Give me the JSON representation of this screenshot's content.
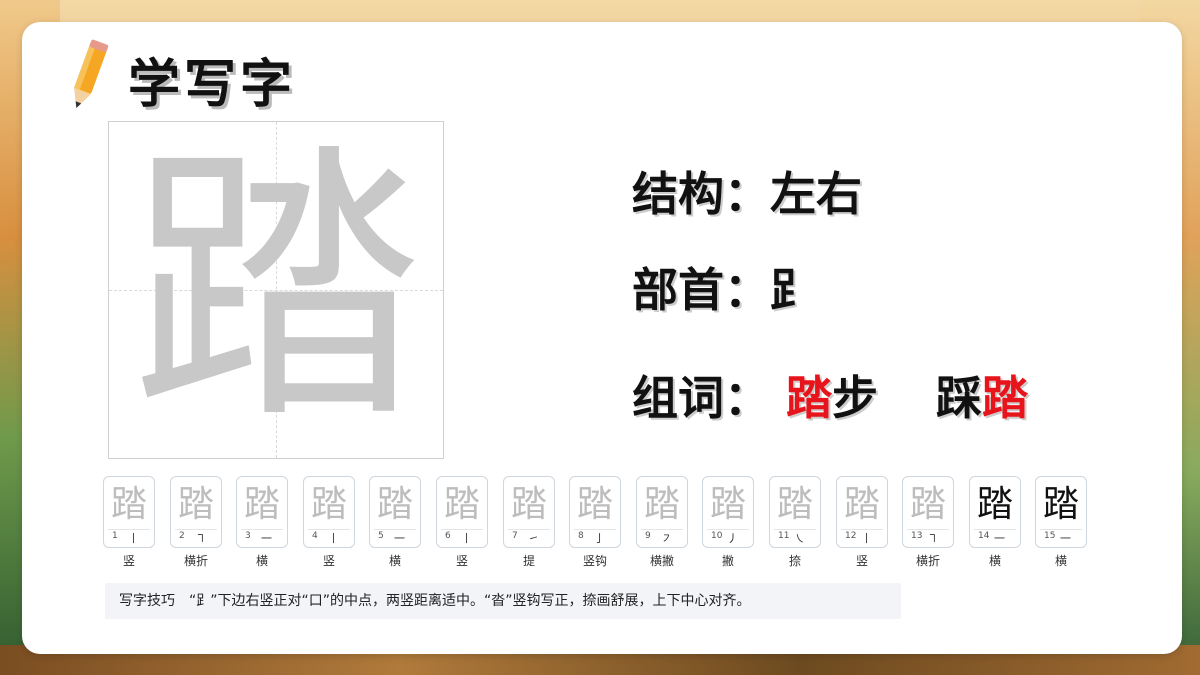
{
  "title": "学写字",
  "character": "踏",
  "structure": {
    "label": "结构：",
    "value": "左右"
  },
  "radical": {
    "label": "部首：",
    "value": "⻊"
  },
  "words": {
    "label": "组词：",
    "items": [
      {
        "parts": [
          {
            "text": "踏",
            "red": true
          },
          {
            "text": "步",
            "red": false
          }
        ]
      },
      {
        "parts": [
          {
            "text": "踩",
            "red": false
          },
          {
            "text": "踏",
            "red": true
          }
        ]
      }
    ]
  },
  "strokes": [
    {
      "num": "1",
      "shape": "丨",
      "name": "竖"
    },
    {
      "num": "2",
      "shape": "㇕",
      "name": "横折"
    },
    {
      "num": "3",
      "shape": "一",
      "name": "横"
    },
    {
      "num": "4",
      "shape": "丨",
      "name": "竖"
    },
    {
      "num": "5",
      "shape": "一",
      "name": "横"
    },
    {
      "num": "6",
      "shape": "丨",
      "name": "竖"
    },
    {
      "num": "7",
      "shape": "㇀",
      "name": "提"
    },
    {
      "num": "8",
      "shape": "亅",
      "name": "竖钩"
    },
    {
      "num": "9",
      "shape": "㇇",
      "name": "横撇"
    },
    {
      "num": "10",
      "shape": "丿",
      "name": "撇"
    },
    {
      "num": "11",
      "shape": "㇏",
      "name": "捺"
    },
    {
      "num": "12",
      "shape": "丨",
      "name": "竖"
    },
    {
      "num": "13",
      "shape": "㇕",
      "name": "横折"
    },
    {
      "num": "14",
      "shape": "一",
      "name": "横"
    },
    {
      "num": "15",
      "shape": "一",
      "name": "横"
    }
  ],
  "tip": {
    "label": "写字技巧",
    "text": "“⻊”下边右竖正对“口”的中点，两竖距离适中。“沓”竖钩写正，捺画舒展，上下中心对齐。"
  },
  "colors": {
    "accent_red": "#e8141b",
    "char_gray": "#c8c8c8"
  }
}
